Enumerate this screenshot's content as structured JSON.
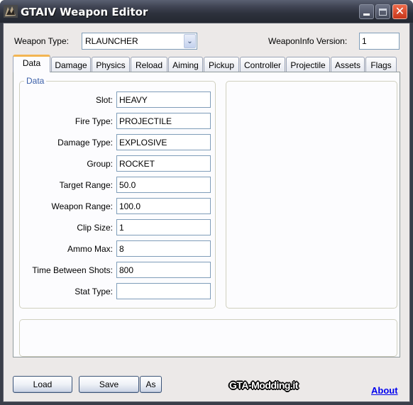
{
  "window": {
    "title": "GTAIV Weapon Editor",
    "controls": {
      "minimize": "minimize",
      "maximize": "maximize",
      "close": "✕"
    }
  },
  "header": {
    "weapon_type_label": "Weapon Type:",
    "weapon_type_value": "RLAUNCHER",
    "weaponinfo_version_label": "WeaponInfo Version:",
    "weaponinfo_version_value": "1"
  },
  "tabs": [
    {
      "label": "Data",
      "active": true
    },
    {
      "label": "Damage",
      "active": false
    },
    {
      "label": "Physics",
      "active": false
    },
    {
      "label": "Reload",
      "active": false
    },
    {
      "label": "Aiming",
      "active": false
    },
    {
      "label": "Pickup",
      "active": false
    },
    {
      "label": "Controller",
      "active": false
    },
    {
      "label": "Projectile",
      "active": false
    },
    {
      "label": "Assets",
      "active": false
    },
    {
      "label": "Flags",
      "active": false
    }
  ],
  "data_group": {
    "legend": "Data",
    "fields": [
      {
        "label": "Slot:",
        "value": "HEAVY"
      },
      {
        "label": "Fire Type:",
        "value": "PROJECTILE"
      },
      {
        "label": "Damage Type:",
        "value": "EXPLOSIVE"
      },
      {
        "label": "Group:",
        "value": "ROCKET"
      },
      {
        "label": "Target Range:",
        "value": "50.0"
      },
      {
        "label": "Weapon Range:",
        "value": "100.0"
      },
      {
        "label": "Clip Size:",
        "value": "1"
      },
      {
        "label": "Ammo Max:",
        "value": "8"
      },
      {
        "label": "Time Between Shots:",
        "value": "800"
      },
      {
        "label": "Stat Type:",
        "value": ""
      }
    ]
  },
  "footer": {
    "load_label": "Load",
    "save_label": "Save",
    "save_as_label": "As",
    "brand_text": "GTA-Modding.it",
    "about_label": "About"
  },
  "colors": {
    "active_tab_accent": "#f3b552",
    "groupbox_legend": "#3a5fa8",
    "link": "#0000ee",
    "close_button": "#d9472a"
  }
}
